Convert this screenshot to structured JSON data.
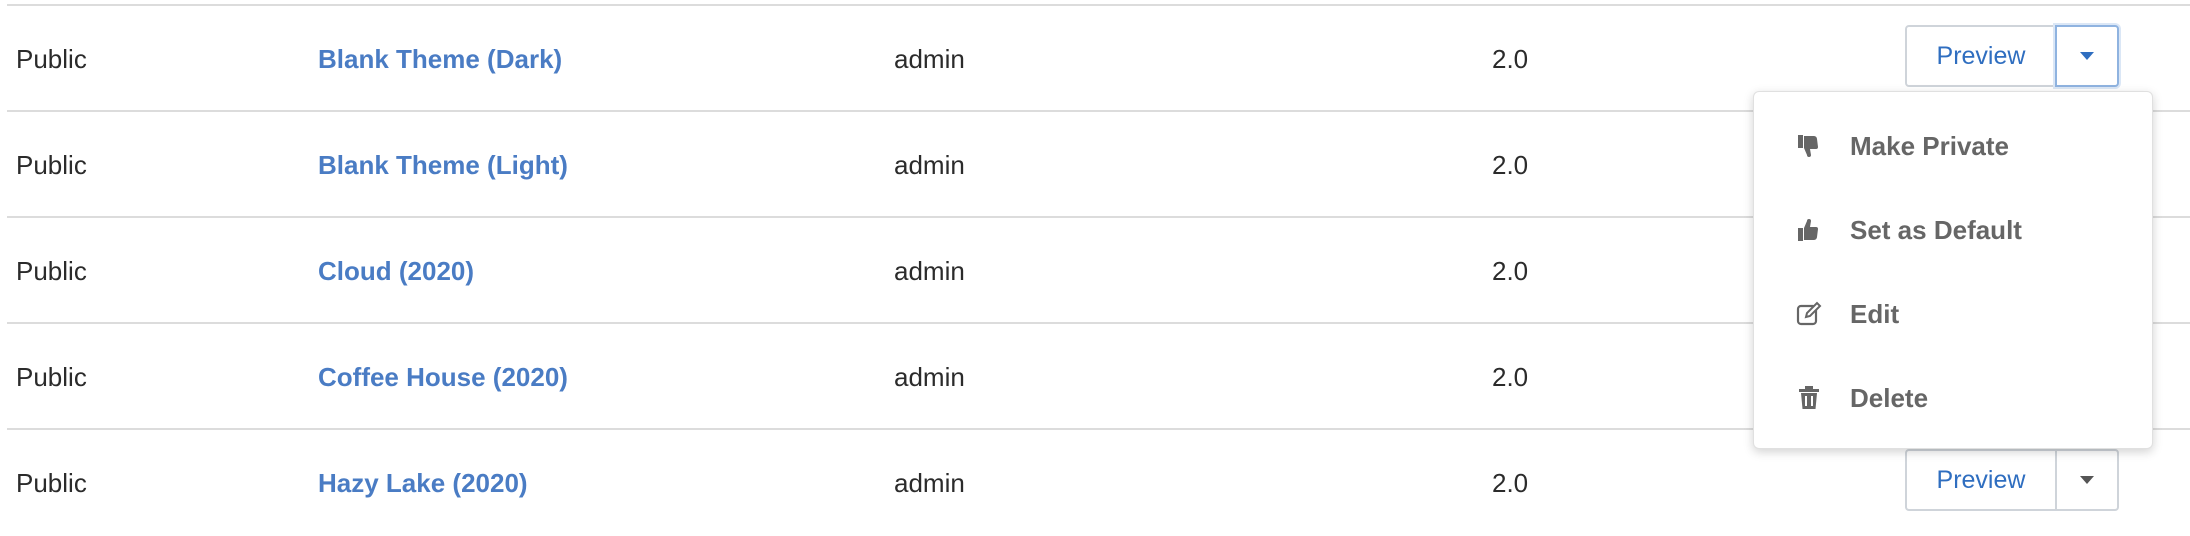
{
  "rows": [
    {
      "visibility": "Public",
      "name": "Blank Theme (Dark)",
      "author": "admin",
      "version": "2.0"
    },
    {
      "visibility": "Public",
      "name": "Blank Theme (Light)",
      "author": "admin",
      "version": "2.0"
    },
    {
      "visibility": "Public",
      "name": "Cloud (2020)",
      "author": "admin",
      "version": "2.0"
    },
    {
      "visibility": "Public",
      "name": "Coffee House (2020)",
      "author": "admin",
      "version": "2.0"
    },
    {
      "visibility": "Public",
      "name": "Hazy Lake (2020)",
      "author": "admin",
      "version": "2.0"
    }
  ],
  "actions": {
    "preview_label": "Preview"
  },
  "dropdown": {
    "items": [
      {
        "label": "Make Private",
        "icon": "thumbs-down-icon"
      },
      {
        "label": "Set as Default",
        "icon": "thumbs-up-icon"
      },
      {
        "label": "Edit",
        "icon": "edit-icon"
      },
      {
        "label": "Delete",
        "icon": "trash-icon"
      }
    ]
  },
  "colors": {
    "link": "#4a7cc4",
    "accent": "#2f6ec0",
    "menu_text": "#666666"
  }
}
